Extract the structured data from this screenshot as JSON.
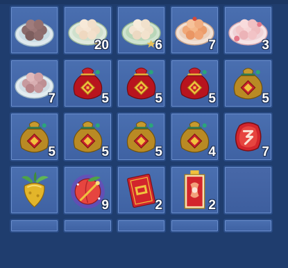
{
  "inventory": {
    "slots": [
      {
        "icon": "dumpling-plate-dark-icon",
        "qty": ""
      },
      {
        "icon": "dumpling-plate-light-icon",
        "qty": "20"
      },
      {
        "icon": "dumpling-plate-green-icon",
        "qty": "6"
      },
      {
        "icon": "dumpling-plate-orange-icon",
        "qty": "7"
      },
      {
        "icon": "dumpling-plate-pink-icon",
        "qty": "3"
      },
      {
        "icon": "dumpling-plate-mixed-icon",
        "qty": "7"
      },
      {
        "icon": "red-lucky-bag-icon",
        "qty": "5"
      },
      {
        "icon": "red-lucky-bag-icon",
        "qty": "5"
      },
      {
        "icon": "red-lucky-bag-icon",
        "qty": "5"
      },
      {
        "icon": "gold-lucky-bag-icon",
        "qty": "5"
      },
      {
        "icon": "gold-lucky-bag-icon",
        "qty": "5"
      },
      {
        "icon": "gold-lucky-bag-icon",
        "qty": "5"
      },
      {
        "icon": "gold-lucky-bag-icon",
        "qty": "5"
      },
      {
        "icon": "gold-lucky-bag-icon",
        "qty": "4"
      },
      {
        "icon": "red-charm-stone-icon",
        "qty": "7"
      },
      {
        "icon": "golden-radish-icon",
        "qty": ""
      },
      {
        "icon": "magic-peach-icon",
        "qty": "9"
      },
      {
        "icon": "red-envelope-icon",
        "qty": "2"
      },
      {
        "icon": "red-scroll-talisman-icon",
        "qty": "2"
      },
      {
        "icon": "",
        "qty": ""
      }
    ]
  }
}
